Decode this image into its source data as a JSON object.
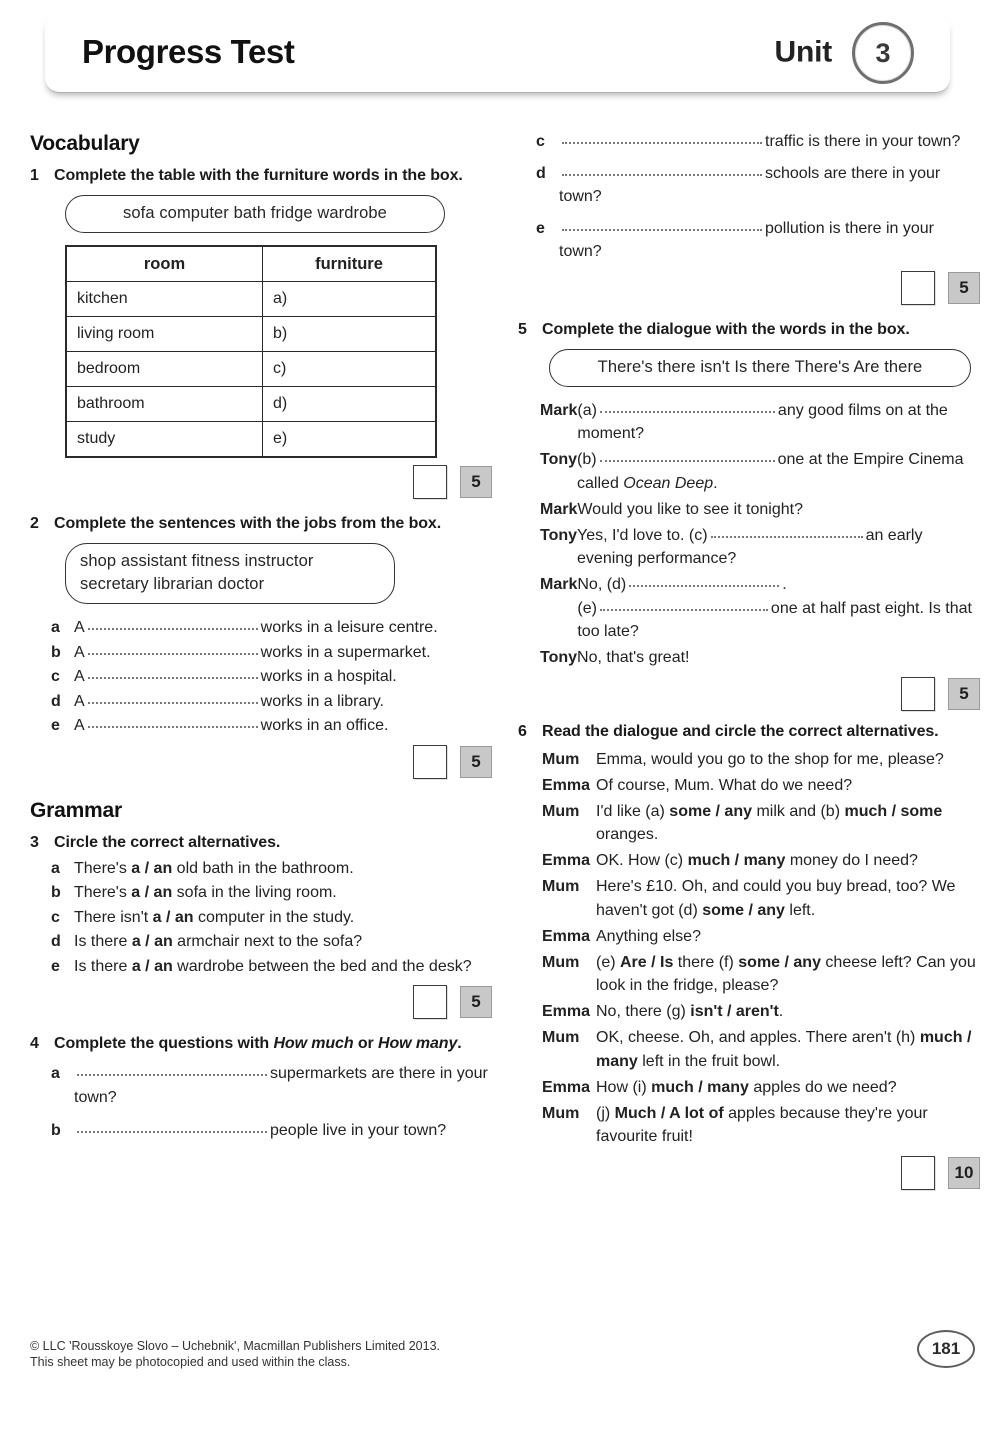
{
  "header": {
    "title": "Progress Test",
    "unit_label": "Unit",
    "unit_number": "3"
  },
  "sections": {
    "vocabulary": "Vocabulary",
    "grammar": "Grammar"
  },
  "exercise1": {
    "number": "1",
    "instruction": "Complete the table with the furniture words in the box.",
    "wordbox": "sofa  computer  bath  fridge  wardrobe",
    "table": {
      "headers": [
        "room",
        "furniture"
      ],
      "rows": [
        [
          "kitchen",
          "a)"
        ],
        [
          "living room",
          "b)"
        ],
        [
          "bedroom",
          "c)"
        ],
        [
          "bathroom",
          "d)"
        ],
        [
          "study",
          "e)"
        ]
      ]
    },
    "score": "5"
  },
  "exercise2": {
    "number": "2",
    "instruction": "Complete the sentences with the jobs from the box.",
    "wordbox_line1": "shop assistant   fitness instructor",
    "wordbox_line2": "secretary   librarian   doctor",
    "items": [
      {
        "letter": "a",
        "before": "A",
        "after": "works in a leisure centre."
      },
      {
        "letter": "b",
        "before": "A",
        "after": "works in a supermarket."
      },
      {
        "letter": "c",
        "before": "A",
        "after": "works in a hospital."
      },
      {
        "letter": "d",
        "before": "A",
        "after": "works in a library."
      },
      {
        "letter": "e",
        "before": "A",
        "after": "works in an office."
      }
    ],
    "score": "5"
  },
  "exercise3": {
    "number": "3",
    "instruction": "Circle the correct alternatives.",
    "items": [
      {
        "letter": "a",
        "pre": "There's ",
        "opt1": "a",
        "opt2": "an",
        "post": " old bath in the bathroom."
      },
      {
        "letter": "b",
        "pre": "There's ",
        "opt1": "a",
        "opt2": "an",
        "post": " sofa in the living room."
      },
      {
        "letter": "c",
        "pre": "There isn't ",
        "opt1": "a",
        "opt2": "an",
        "post": " computer in the study."
      },
      {
        "letter": "d",
        "pre": "Is there ",
        "opt1": "a",
        "opt2": "an",
        "post": " armchair next to the sofa?"
      },
      {
        "letter": "e",
        "pre": "Is there ",
        "opt1": "a",
        "opt2": "an",
        "post": " wardrobe between the bed and the desk?"
      }
    ],
    "score": "5"
  },
  "exercise4": {
    "number": "4",
    "instruction_pre": "Complete the questions with ",
    "instruction_italic1": "How much",
    "instruction_mid": " or ",
    "instruction_italic2": "How many",
    "instruction_end": ".",
    "items": [
      {
        "letter": "a",
        "after": "supermarkets are there in your town?"
      },
      {
        "letter": "b",
        "after": "people live in your town?"
      },
      {
        "letter": "c",
        "after": "traffic is there in your town?"
      },
      {
        "letter": "d",
        "after": "schools are there in your town?"
      },
      {
        "letter": "e",
        "after": "pollution is there in your town?"
      }
    ],
    "score": "5"
  },
  "exercise5": {
    "number": "5",
    "instruction": "Complete the dialogue with the words in the box.",
    "wordbox": "There's   there isn't   Is there   There's   Are there",
    "dialogue": [
      {
        "speaker": "Mark",
        "gap": "(a)",
        "text": "any good  films on at the moment?"
      },
      {
        "speaker": "Tony",
        "gap": "(b)",
        "text": "one at the Empire Cinema called ",
        "italic": "Ocean Deep",
        "text_end": "."
      },
      {
        "speaker": "Mark",
        "text": "Would you like to see it tonight?"
      },
      {
        "speaker": "Tony",
        "pre": "Yes, I'd love to. ",
        "gap": "(c)",
        "text": "an early evening performance?"
      },
      {
        "speaker": "Mark",
        "pre": "No, ",
        "gap": "(d)",
        "text": ".",
        "gap2": "(e)",
        "text2": "one at half past eight. Is that too late?"
      },
      {
        "speaker": "Tony",
        "text": "No, that's great!"
      }
    ],
    "score": "5"
  },
  "exercise6": {
    "number": "6",
    "instruction": "Read the dialogue and circle the correct alternatives.",
    "dialogue": [
      {
        "speaker": "Mum",
        "parts": [
          {
            "t": "Emma, would you go to the shop for me, please?"
          }
        ]
      },
      {
        "speaker": "Emma",
        "parts": [
          {
            "t": "Of course, Mum. What do we need?"
          }
        ]
      },
      {
        "speaker": "Mum",
        "parts": [
          {
            "t": "I'd like (a) "
          },
          {
            "b": "some / any"
          },
          {
            "t": " milk and (b) "
          },
          {
            "b": "much / some"
          },
          {
            "t": " oranges."
          }
        ]
      },
      {
        "speaker": "Emma",
        "parts": [
          {
            "t": "OK. How (c) "
          },
          {
            "b": "much / many"
          },
          {
            "t": " money do I need?"
          }
        ]
      },
      {
        "speaker": "Mum",
        "parts": [
          {
            "t": "Here's £10. Oh, and could you buy bread, too? We haven't got (d) "
          },
          {
            "b": "some / any"
          },
          {
            "t": " left."
          }
        ]
      },
      {
        "speaker": "Emma",
        "parts": [
          {
            "t": "Anything else?"
          }
        ]
      },
      {
        "speaker": "Mum",
        "parts": [
          {
            "t": "(e) "
          },
          {
            "b": "Are / Is"
          },
          {
            "t": " there (f) "
          },
          {
            "b": "some / any"
          },
          {
            "t": " cheese left? Can you look in the fridge, please?"
          }
        ]
      },
      {
        "speaker": "Emma",
        "parts": [
          {
            "t": "No, there (g) "
          },
          {
            "b": "isn't / aren't"
          },
          {
            "t": "."
          }
        ]
      },
      {
        "speaker": "Mum",
        "parts": [
          {
            "t": "OK, cheese. Oh, and apples. There aren't (h) "
          },
          {
            "b": "much / many"
          },
          {
            "t": " left in the fruit bowl."
          }
        ]
      },
      {
        "speaker": "Emma",
        "parts": [
          {
            "t": "How (i) "
          },
          {
            "b": "much / many"
          },
          {
            "t": " apples do we need?"
          }
        ]
      },
      {
        "speaker": "Mum",
        "parts": [
          {
            "t": "(j) "
          },
          {
            "b": "Much / A lot of"
          },
          {
            "t": " apples because they're your favourite fruit!"
          }
        ]
      }
    ],
    "score": "10"
  },
  "footer": {
    "line1": "© LLC 'Rousskoye Slovo – Uchebnik', Macmillan Publishers Limited 2013.",
    "line2": "This sheet may be photocopied and used within the class.",
    "page_number": "181"
  }
}
